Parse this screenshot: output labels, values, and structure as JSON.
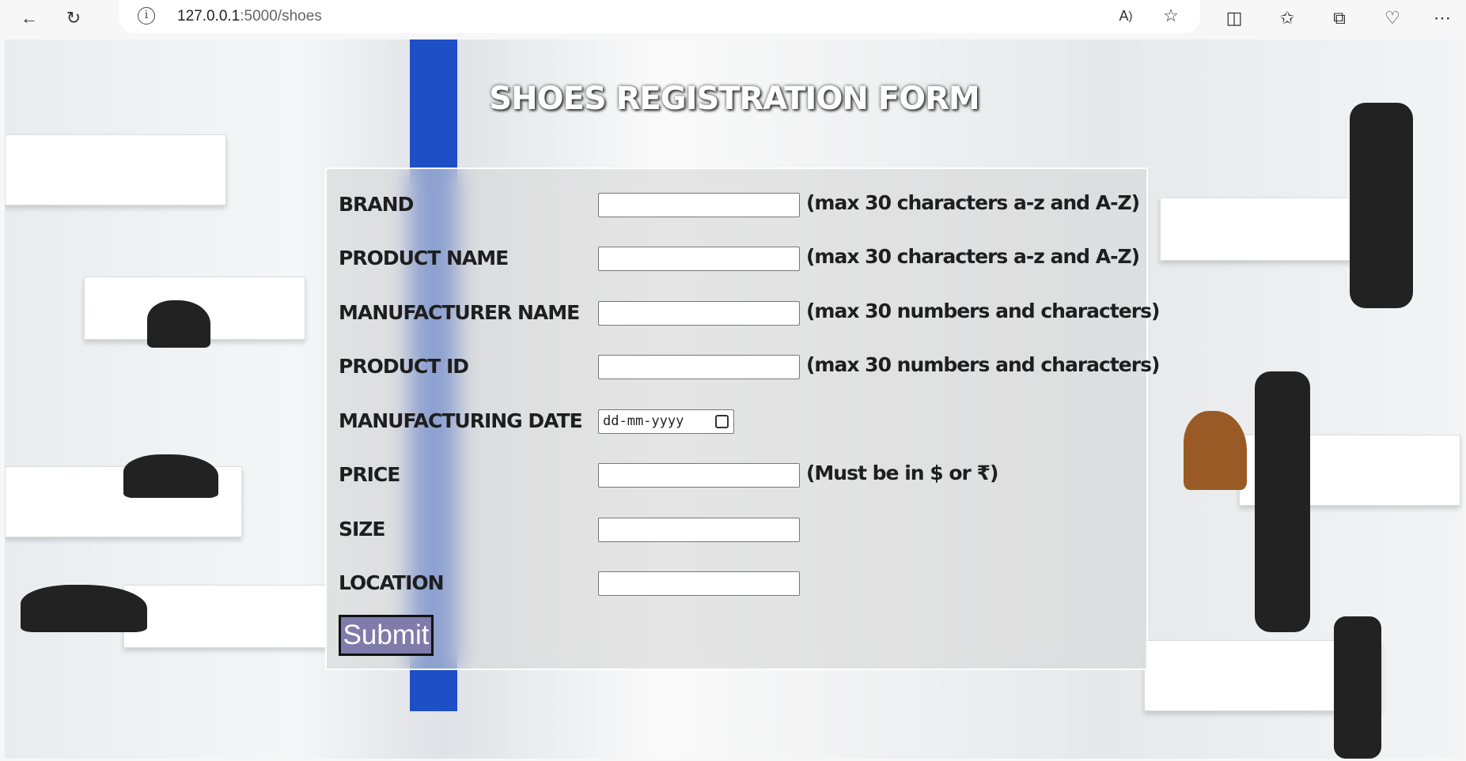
{
  "browser": {
    "url_host": "127.0.0.1",
    "url_rest": ":5000/shoes"
  },
  "page": {
    "title": "SHOES REGISTRATION FORM"
  },
  "form": {
    "fields": [
      {
        "label": "BRAND",
        "value": "",
        "hint": "(max 30 characters a-z and A-Z)"
      },
      {
        "label": "PRODUCT NAME",
        "value": "",
        "hint": "(max 30 characters a-z and A-Z)"
      },
      {
        "label": "MANUFACTURER NAME",
        "value": "",
        "hint": "(max 30 numbers and characters)"
      },
      {
        "label": "PRODUCT ID",
        "value": "",
        "hint": "(max 30 numbers and characters)"
      },
      {
        "label": "MANUFACTURING DATE",
        "placeholder": "dd-mm-yyyy"
      },
      {
        "label": "PRICE",
        "value": "",
        "hint": "(Must be in $ or ₹)"
      },
      {
        "label": "SIZE",
        "value": ""
      },
      {
        "label": "LOCATION",
        "value": ""
      }
    ],
    "submit_label": "Submit"
  },
  "colors": {
    "submit_bg": "#7f7bab",
    "accent_blue": "#1e4fc6"
  }
}
